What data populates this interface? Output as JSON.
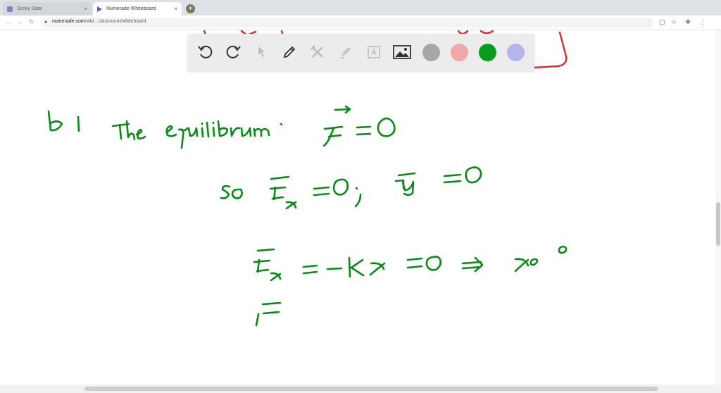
{
  "browser": {
    "tabs": [
      {
        "label": "Sticky Data",
        "favicon_color": "#8a7cc8",
        "active": false
      },
      {
        "label": "Numerade Whiteboard",
        "favicon_color": "#5b5bd6",
        "active": true
      }
    ],
    "new_tab_symbol": "+",
    "close_symbol": "×",
    "address": {
      "host": "numerade.com",
      "path": "/wb/...classroom/whiteboard"
    }
  },
  "toolbar": {
    "tools": [
      "undo-icon",
      "redo-icon",
      "select-icon",
      "pen-icon",
      "tools-icon",
      "highlighter-icon",
      "text-box-icon",
      "image-icon"
    ],
    "colors": [
      "#a7a7a7",
      "#f0a8a8",
      "#0a9a1e",
      "#b4b4ee"
    ],
    "selected_color": "#0a9a1e"
  },
  "ink": {
    "red": "#e3262a",
    "green": "#0a8a16",
    "green_light": "#19a82c"
  }
}
